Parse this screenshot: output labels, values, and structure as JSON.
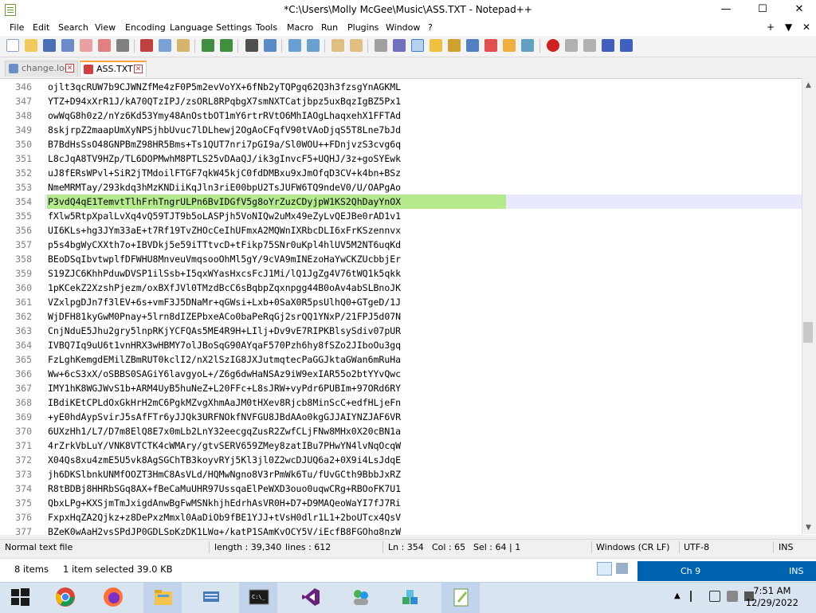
{
  "window": {
    "title": "*C:\\Users\\Molly McGee\\Music\\ASS.TXT - Notepad++",
    "minimize": "—",
    "maximize": "☐",
    "close": "✕"
  },
  "menu": {
    "items": [
      "File",
      "Edit",
      "Search",
      "View",
      "Encoding",
      "Language",
      "Settings",
      "Tools",
      "Macro",
      "Run",
      "Plugins",
      "Window",
      "?"
    ],
    "right": [
      "+",
      "▼",
      "✕"
    ]
  },
  "tabs": [
    {
      "label": "change.log",
      "active": false
    },
    {
      "label": "ASS.TXT",
      "active": true
    }
  ],
  "editor": {
    "current_line": 354,
    "lines": [
      {
        "n": "346",
        "text": "ojlt3qcRUW7b9CJWNZfMe4zF0P5m2evVoYX+6fNb2yTQPgq62Q3h3fzsgYnAGKML"
      },
      {
        "n": "347",
        "text": "YTZ+D94xXrR1J/kA70QTzIPJ/zsORL8RPqbgX7smNXTCatjbpz5uxBqzIgBZ5Px1"
      },
      {
        "n": "348",
        "text": "owWqG8h0z2/nYz6Kd53Ymy48AnOstbOT1mY6rtrRVtO6MhIAOgLhaqxehX1FFTAd"
      },
      {
        "n": "349",
        "text": "8skjrpZ2maapUmXyNPSjhbUvuc7lDLhewj2OgAoCFqfV90tVAoDjqS5T8Lne7bJd"
      },
      {
        "n": "350",
        "text": "B7BdHsSsO48GNPBmZ98HR5Bms+Ts1QUT7nri7pGI9a/Sl0WOU++FDnjvzS3cvg6q"
      },
      {
        "n": "351",
        "text": "L8cJqA8TV9HZp/TL6DOPMwhM8PTLS25vDAaQJ/ik3gInvcF5+UQHJ/3z+goSYEwk"
      },
      {
        "n": "352",
        "text": "uJ8fERsWPvl+SiR2jTMdoilFTGF7qkW45kjC0fdDMBxu9xJmOfqD3CV+k4bn+BSz"
      },
      {
        "n": "353",
        "text": "NmeMRMTay/293kdq3hMzKNDiiKqJln3riE00bpU2TsJUFW6TQ9ndeV0/U/OAPgAo"
      },
      {
        "n": "354",
        "text": "P3vdQ4qE1TemvtTlhFrhTngrULPn6BvIDGfV5g8oYrZuzCDyjpW1KS2QhDayYnOX"
      },
      {
        "n": "355",
        "text": "fXlw5RtpXpalLvXq4vQ59TJT9b5oLASPjh5VoNIQw2uMx49eZyLvQEJBe0rAD1v1"
      },
      {
        "n": "356",
        "text": "UI6KLs+hg3JYm33aE+t7Rf19TvZHOcCeIhUFmxA2MQWnIXRbcDLI6xFrKSzennvx"
      },
      {
        "n": "357",
        "text": "p5s4bgWyCXXth7o+IBVDkj5e59iTTtvcD+tFikp75SNr0uKpl4hlUV5M2NT6uqKd"
      },
      {
        "n": "358",
        "text": "BEoDSqIbvtwplfDFWHU8MnveuVmqsooOhMl5gY/9cVA9mINEzoHaYwCKZUcbbjEr"
      },
      {
        "n": "359",
        "text": "S19ZJC6KhhPduwDVSP1ilSsb+I5qxWYasHxcsFcJ1Mi/lQ1JgZg4V76tWQ1k5qkk"
      },
      {
        "n": "360",
        "text": "1pKCekZ2XzshPjezm/oxBXfJVl0TMzdBcC6sBqbpZqxnpgg44B0oAv4abSLBnoJK"
      },
      {
        "n": "361",
        "text": "VZxlpgDJn7f3lEV+6s+vmF3J5DNaMr+qGWsi+Lxb+0SaX0R5psUlhQ0+GTgeD/1J"
      },
      {
        "n": "362",
        "text": "WjDFH81kyGwM0Pnay+5lrn8dIZEPbxeACo0baPeRqGj2srQQ1YNxP/21FPJ5d07N"
      },
      {
        "n": "363",
        "text": "CnjNduE5Jhu2gry5lnpRKjYCFQAs5ME4R9H+LIlj+Dv9vE7RIPKBlsySdiv07pUR"
      },
      {
        "n": "364",
        "text": "IVBQ7Iq9uU6t1vnHRX3wHBMY7olJBoSqG90AYqaF570Pzh6hy8fSZo2JIboOu3gq"
      },
      {
        "n": "365",
        "text": "FzLghKemgdEMilZBmRUT0kclI2/nX2lSzIG8JXJutmqtecPaGGJktaGWan6mRuHa"
      },
      {
        "n": "366",
        "text": "Ww+6cS3xX/oSBBS0SAGiY6lavgyoL+/Z6g6dwHaNSAz9iW9exIAR55o2btYYvQwc"
      },
      {
        "n": "367",
        "text": "IMY1hK8WGJWvS1b+ARM4UyB5huNeZ+L20FFc+L8sJRW+vyPdr6PUBIm+97ORd6RY"
      },
      {
        "n": "368",
        "text": "IBdiKEtCPLdOxGkHrH2mC6PgkMZvgXhmAaJM0tHXev8Rjcb8MinScC+edfHLjeFn"
      },
      {
        "n": "369",
        "text": "+yE0hdAypSvirJ5sAfFTr6yJJQk3URFNOkfNVFGU8JBdAAo0kgGJJAIYNZJAF6VR"
      },
      {
        "n": "370",
        "text": "6UXzHh1/L7/D7m8ElQ8E7x0mLb2LnY32eecgqZusR2ZwfCLjFNw8MHx0X20cBN1a"
      },
      {
        "n": "371",
        "text": "4rZrkVbLuY/VNK8VTCTK4cWMAry/gtvSERV659ZMey8zatIBu7PHwYN4lvNqOcqW"
      },
      {
        "n": "372",
        "text": "X04Qs8xu4zmE5U5vk8AgSGChTB3koyvRYj5Kl3jl0Z2wcDJUQ6a2+0X9i4LsJdqE"
      },
      {
        "n": "373",
        "text": "jh6DKSlbnkUNMfOOZT3HmC8AsVLd/HQMwNgno8V3rPmWk6Tu/fUvGCth9BbbJxRZ"
      },
      {
        "n": "374",
        "text": "R8tBDBj8HHRbSGq8AX+fBeCaMuUHR97UssqaElPeWXD3ouo0uqwCRg+RBOoFK7U1"
      },
      {
        "n": "375",
        "text": "QbxLPg+KXSjmTmJxigdAnwBgFwMSNkhjhEdrhAsVR0H+D7+D9MAQeoWaYI7fJ7Ri"
      },
      {
        "n": "376",
        "text": "FxpxHqZA2Qjkz+z8DePxzMmxl0AaDiOb9fBE1YJJ+tVsH0dlr1L1+2boUTcx4QsV"
      },
      {
        "n": "377",
        "text": "BZeK0wAaH2vsSPdJP0GDLSpKzDK1LWg+/katP1SAmKyOCY5V/iEcfB8FGOhg8nzW"
      }
    ]
  },
  "status": {
    "file_type": "Normal text file",
    "length": "length : 39,340",
    "lines": "lines : 612",
    "ln": "Ln : 354",
    "col": "Col : 65",
    "sel": "Sel : 64 | 1",
    "eol": "Windows (CR LF)",
    "encoding": "UTF-8",
    "mode": "INS"
  },
  "strip2": {
    "items": "8 items",
    "selected": "1 item selected  39.0 KB",
    "column": "Ch 9",
    "mode": "INS"
  },
  "taskbar": {
    "time": "7:51 AM",
    "date": "12/29/2022"
  },
  "colors": {
    "selection": "#b4ea8c",
    "current_line": "#e8e8ff",
    "tab_accent": "#f7a53c",
    "taskbar": "#d9e4f1",
    "strip_blue": "#0063b1"
  }
}
